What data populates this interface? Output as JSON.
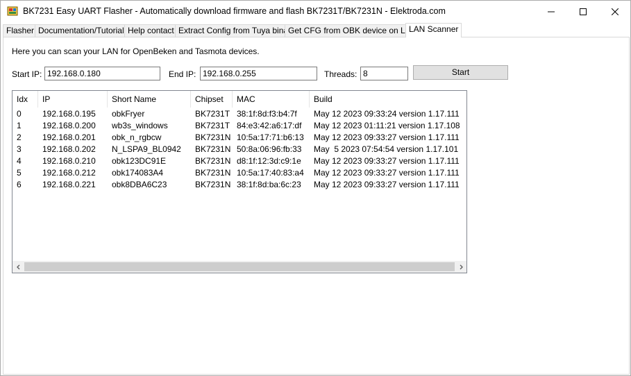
{
  "window": {
    "title": "BK7231 Easy UART Flasher - Automatically download firmware and flash BK7231T/BK7231N  - Elektroda.com"
  },
  "tabs": [
    {
      "label": "Flasher"
    },
    {
      "label": "Documentation/Tutorials"
    },
    {
      "label": "Help contact"
    },
    {
      "label": "Extract Config from Tuya binary"
    },
    {
      "label": "Get CFG from OBK device on LAN"
    },
    {
      "label": "LAN Scanner"
    }
  ],
  "scanner": {
    "intro": "Here you can scan your LAN for OpenBeken and Tasmota devices.",
    "start_ip_label": "Start IP:",
    "start_ip_value": "192.168.0.180",
    "end_ip_label": "End IP:",
    "end_ip_value": "192.168.0.255",
    "threads_label": "Threads:",
    "threads_value": "8",
    "start_button": "Start"
  },
  "table": {
    "columns": [
      "Idx",
      "IP",
      "Short Name",
      "Chipset",
      "MAC",
      "Build"
    ],
    "rows": [
      {
        "idx": "0",
        "ip": "192.168.0.195",
        "name": "obkFryer",
        "chipset": "BK7231T",
        "mac": "38:1f:8d:f3:b4:7f",
        "build": "May 12 2023 09:33:24 version 1.17.111"
      },
      {
        "idx": "1",
        "ip": "192.168.0.200",
        "name": "wb3s_windows",
        "chipset": "BK7231T",
        "mac": "84:e3:42:a6:17:df",
        "build": "May 12 2023 01:11:21 version 1.17.108"
      },
      {
        "idx": "2",
        "ip": "192.168.0.201",
        "name": "obk_n_rgbcw",
        "chipset": "BK7231N",
        "mac": "10:5a:17:71:b6:13",
        "build": "May 12 2023 09:33:27 version 1.17.111"
      },
      {
        "idx": "3",
        "ip": "192.168.0.202",
        "name": "N_LSPA9_BL0942",
        "chipset": "BK7231N",
        "mac": "50:8a:06:96:fb:33",
        "build": "May  5 2023 07:54:54 version 1.17.101"
      },
      {
        "idx": "4",
        "ip": "192.168.0.210",
        "name": "obk123DC91E",
        "chipset": "BK7231N",
        "mac": "d8:1f:12:3d:c9:1e",
        "build": "May 12 2023 09:33:27 version 1.17.111"
      },
      {
        "idx": "5",
        "ip": "192.168.0.212",
        "name": "obk174083A4",
        "chipset": "BK7231N",
        "mac": "10:5a:17:40:83:a4",
        "build": "May 12 2023 09:33:27 version 1.17.111"
      },
      {
        "idx": "6",
        "ip": "192.168.0.221",
        "name": "obk8DBA6C23",
        "chipset": "BK7231N",
        "mac": "38:1f:8d:ba:6c:23",
        "build": "May 12 2023 09:33:27 version 1.17.111"
      }
    ]
  },
  "icons": {
    "app": "app-icon",
    "minimize": "minimize-icon",
    "maximize": "maximize-icon",
    "close": "close-icon",
    "scroll_left": "chevron-left-icon",
    "scroll_right": "chevron-right-icon"
  },
  "colors": {
    "tab_inactive": "#f0f0f0",
    "button_face": "#e1e1e1",
    "scrollbar_thumb": "#cdcdcd"
  }
}
